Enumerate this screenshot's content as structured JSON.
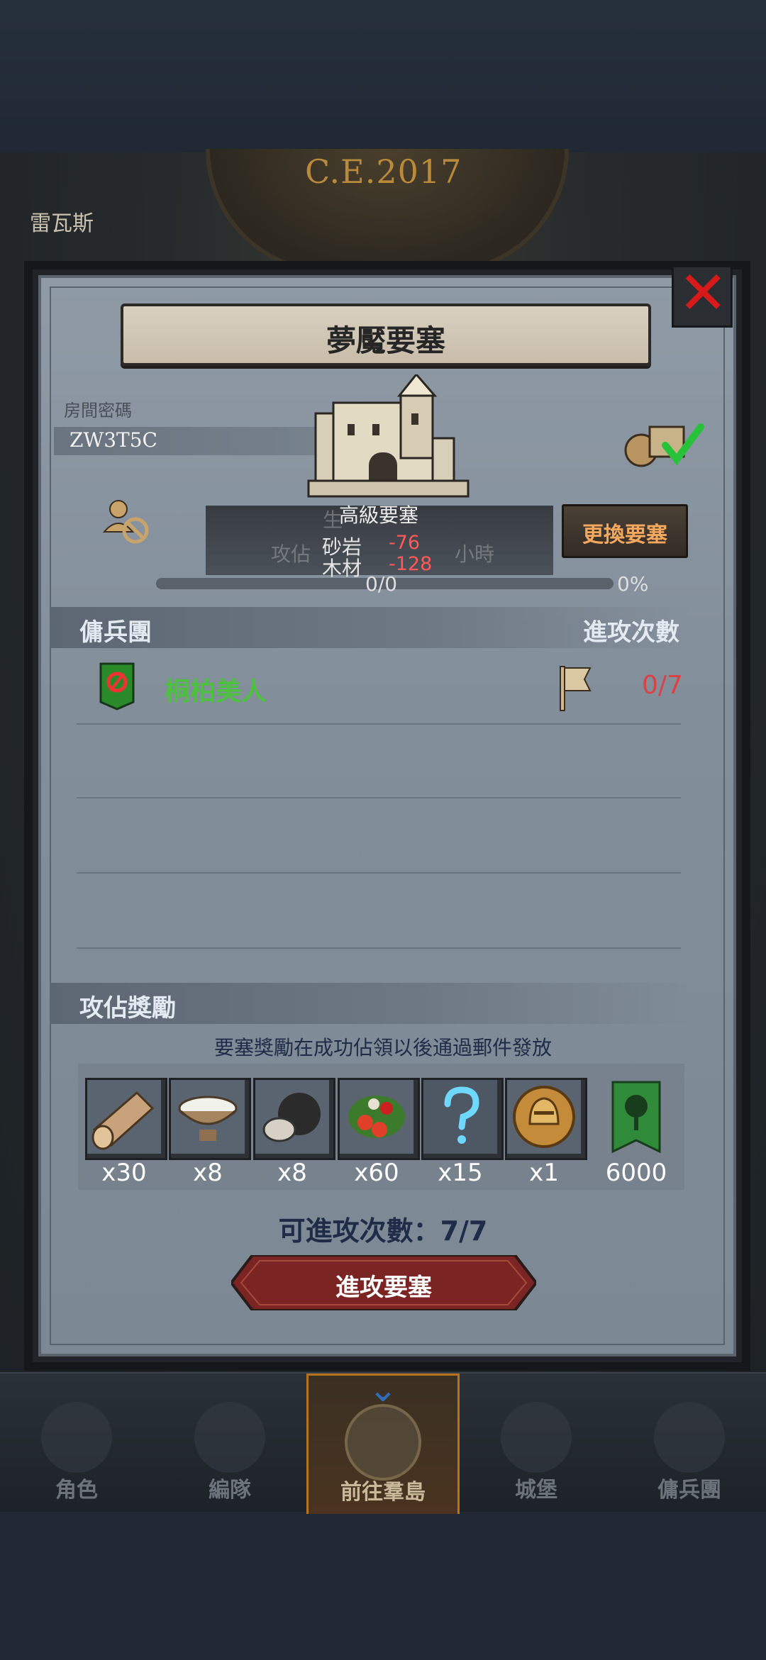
{
  "background": {
    "map_year": "C.E.2017",
    "map_city": "雷瓦斯"
  },
  "panel": {
    "title": "夢魘要塞",
    "room_label": "房間密碼",
    "room_code": "ZW3T5C",
    "fortress_grade": "高級要塞",
    "resources": [
      {
        "name": "砂岩",
        "value": "-76"
      },
      {
        "name": "木材",
        "value": "-128"
      }
    ],
    "overlapped_text": {
      "production": "生",
      "attack_time": "攻佔",
      "hours": "小時"
    },
    "switch_button": "更換要塞",
    "progress": {
      "text": "0/0",
      "percent": "0%",
      "fraction": 0
    }
  },
  "mercenary": {
    "header_left": "傭兵團",
    "header_right": "進攻次數",
    "entries": [
      {
        "name": "桐柏美人",
        "count": "0/7"
      }
    ]
  },
  "rewards": {
    "header": "攻佔獎勵",
    "note": "要塞獎勵在成功佔領以後通過郵件發放",
    "items": [
      {
        "icon": "wood-log-icon",
        "qty": "x30"
      },
      {
        "icon": "salt-bowl-icon",
        "qty": "x8"
      },
      {
        "icon": "ore-stone-icon",
        "qty": "x8"
      },
      {
        "icon": "berries-icon",
        "qty": "x60"
      },
      {
        "icon": "mystery-question-icon",
        "qty": "x15"
      },
      {
        "icon": "knight-helmet-coin-icon",
        "qty": "x1"
      },
      {
        "icon": "tree-banner-icon",
        "qty": "6000"
      }
    ]
  },
  "attempts_text": "可進攻次數：7/7",
  "attack_button": "進攻要塞",
  "nav": [
    {
      "label": "角色",
      "icon": "knight-icon"
    },
    {
      "label": "編隊",
      "icon": "helmet-icon"
    },
    {
      "label": "前往羣島",
      "icon": "globe-icon"
    },
    {
      "label": "城堡",
      "icon": "castle-icon"
    },
    {
      "label": "傭兵團",
      "icon": "mercenary-icon"
    }
  ],
  "colors": {
    "accent_red": "#d61a1a",
    "merc_green": "#4ec03f",
    "count_red": "#d94346",
    "button_orange": "#f3a85d",
    "nav_active": "#b5731e"
  }
}
